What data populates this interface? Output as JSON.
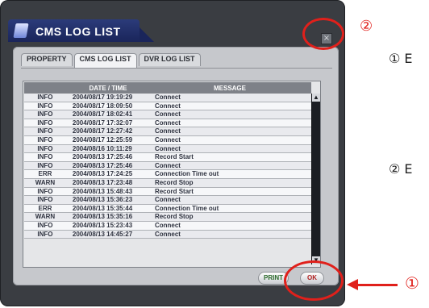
{
  "window": {
    "title": "CMS LOG LIST",
    "close_glyph": "×"
  },
  "tabs": [
    {
      "label": "PROPERTY",
      "active": false
    },
    {
      "label": "CMS LOG LIST",
      "active": true
    },
    {
      "label": "DVR LOG LIST",
      "active": false
    }
  ],
  "table": {
    "headers": {
      "level": "",
      "time": "DATE / TIME",
      "message": "MESSAGE"
    },
    "rows": [
      {
        "level": "INFO",
        "time": "2004/08/17 19:19:29",
        "message": "Connect"
      },
      {
        "level": "INFO",
        "time": "2004/08/17 18:09:50",
        "message": "Connect"
      },
      {
        "level": "INFO",
        "time": "2004/08/17 18:02:41",
        "message": "Connect"
      },
      {
        "level": "INFO",
        "time": "2004/08/17 17:32:07",
        "message": "Connect"
      },
      {
        "level": "INFO",
        "time": "2004/08/17 12:27:42",
        "message": "Connect"
      },
      {
        "level": "INFO",
        "time": "2004/08/17 12:25:59",
        "message": "Connect"
      },
      {
        "level": "INFO",
        "time": "2004/08/16 10:11:29",
        "message": "Connect"
      },
      {
        "level": "INFO",
        "time": "2004/08/13 17:25:46",
        "message": "Record Start"
      },
      {
        "level": "INFO",
        "time": "2004/08/13 17:25:46",
        "message": "Connect"
      },
      {
        "level": "ERR",
        "time": "2004/08/13 17:24:25",
        "message": "Connection Time out"
      },
      {
        "level": "WARN",
        "time": "2004/08/13 17:23:48",
        "message": "Record Stop"
      },
      {
        "level": "INFO",
        "time": "2004/08/13 15:48:43",
        "message": "Record Start"
      },
      {
        "level": "INFO",
        "time": "2004/08/13 15:36:23",
        "message": "Connect"
      },
      {
        "level": "ERR",
        "time": "2004/08/13 15:35:44",
        "message": "Connection Time out"
      },
      {
        "level": "WARN",
        "time": "2004/08/13 15:35:16",
        "message": "Record Stop"
      },
      {
        "level": "INFO",
        "time": "2004/08/13 15:23:43",
        "message": "Connect"
      },
      {
        "level": "INFO",
        "time": "2004/08/13 14:45:27",
        "message": "Connect"
      }
    ]
  },
  "buttons": {
    "print": "PRINT",
    "ok": "OK"
  },
  "annotations": {
    "marker_1": "①",
    "marker_2": "②",
    "side_1": "① E",
    "side_2": "② E",
    "color": "#e0201b"
  }
}
